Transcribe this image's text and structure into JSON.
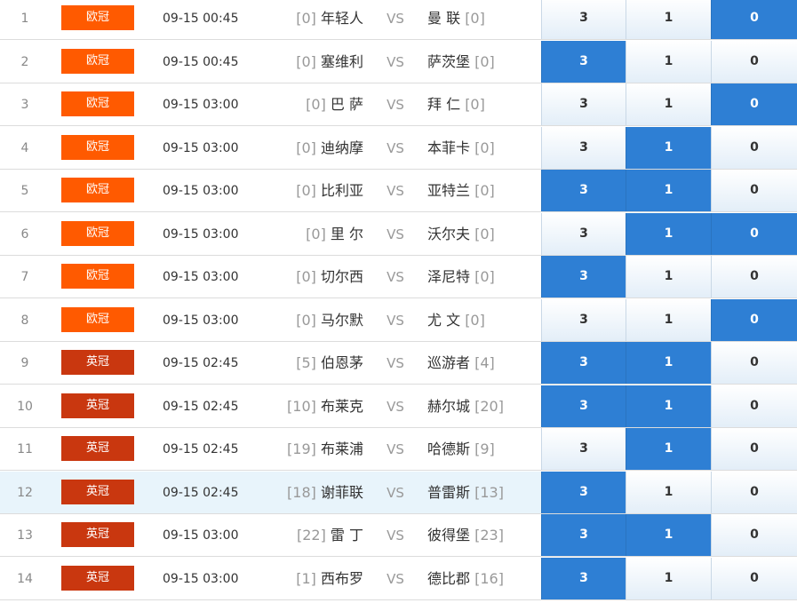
{
  "colors": {
    "league_ouguan": "#ff5a00",
    "league_yingguan": "#c9370f",
    "selected": "#2e7fd4",
    "highlight_row": "#e8f4fb"
  },
  "vs_label": "VS",
  "rows": [
    {
      "idx": "1",
      "league": "欧冠",
      "time": "09-15 00:45",
      "home_rank": "[0]",
      "home": "年轻人",
      "away": "曼 联",
      "away_rank": "[0]",
      "o3": "3",
      "o1": "1",
      "o0": "0"
    },
    {
      "idx": "2",
      "league": "欧冠",
      "time": "09-15 00:45",
      "home_rank": "[0]",
      "home": "塞维利",
      "away": "萨茨堡",
      "away_rank": "[0]",
      "o3": "3",
      "o1": "1",
      "o0": "0"
    },
    {
      "idx": "3",
      "league": "欧冠",
      "time": "09-15 03:00",
      "home_rank": "[0]",
      "home": "巴 萨",
      "away": "拜 仁",
      "away_rank": "[0]",
      "o3": "3",
      "o1": "1",
      "o0": "0"
    },
    {
      "idx": "4",
      "league": "欧冠",
      "time": "09-15 03:00",
      "home_rank": "[0]",
      "home": "迪纳摩",
      "away": "本菲卡",
      "away_rank": "[0]",
      "o3": "3",
      "o1": "1",
      "o0": "0"
    },
    {
      "idx": "5",
      "league": "欧冠",
      "time": "09-15 03:00",
      "home_rank": "[0]",
      "home": "比利亚",
      "away": "亚特兰",
      "away_rank": "[0]",
      "o3": "3",
      "o1": "1",
      "o0": "0"
    },
    {
      "idx": "6",
      "league": "欧冠",
      "time": "09-15 03:00",
      "home_rank": "[0]",
      "home": "里 尔",
      "away": "沃尔夫",
      "away_rank": "[0]",
      "o3": "3",
      "o1": "1",
      "o0": "0"
    },
    {
      "idx": "7",
      "league": "欧冠",
      "time": "09-15 03:00",
      "home_rank": "[0]",
      "home": "切尔西",
      "away": "泽尼特",
      "away_rank": "[0]",
      "o3": "3",
      "o1": "1",
      "o0": "0"
    },
    {
      "idx": "8",
      "league": "欧冠",
      "time": "09-15 03:00",
      "home_rank": "[0]",
      "home": "马尔默",
      "away": "尤 文",
      "away_rank": "[0]",
      "o3": "3",
      "o1": "1",
      "o0": "0"
    },
    {
      "idx": "9",
      "league": "英冠",
      "time": "09-15 02:45",
      "home_rank": "[5]",
      "home": "伯恩茅",
      "away": "巡游者",
      "away_rank": "[4]",
      "o3": "3",
      "o1": "1",
      "o0": "0"
    },
    {
      "idx": "10",
      "league": "英冠",
      "time": "09-15 02:45",
      "home_rank": "[10]",
      "home": "布莱克",
      "away": "赫尔城",
      "away_rank": "[20]",
      "o3": "3",
      "o1": "1",
      "o0": "0"
    },
    {
      "idx": "11",
      "league": "英冠",
      "time": "09-15 02:45",
      "home_rank": "[19]",
      "home": "布莱浦",
      "away": "哈德斯",
      "away_rank": "[9]",
      "o3": "3",
      "o1": "1",
      "o0": "0"
    },
    {
      "idx": "12",
      "league": "英冠",
      "time": "09-15 02:45",
      "home_rank": "[18]",
      "home": "谢菲联",
      "away": "普雷斯",
      "away_rank": "[13]",
      "o3": "3",
      "o1": "1",
      "o0": "0"
    },
    {
      "idx": "13",
      "league": "英冠",
      "time": "09-15 03:00",
      "home_rank": "[22]",
      "home": "雷 丁",
      "away": "彼得堡",
      "away_rank": "[23]",
      "o3": "3",
      "o1": "1",
      "o0": "0"
    },
    {
      "idx": "14",
      "league": "英冠",
      "time": "09-15 03:00",
      "home_rank": "[1]",
      "home": "西布罗",
      "away": "德比郡",
      "away_rank": "[16]",
      "o3": "3",
      "o1": "1",
      "o0": "0"
    }
  ],
  "selection": [
    [
      false,
      false,
      true
    ],
    [
      true,
      false,
      false
    ],
    [
      false,
      false,
      true
    ],
    [
      false,
      true,
      false
    ],
    [
      true,
      true,
      false
    ],
    [
      false,
      true,
      true
    ],
    [
      true,
      false,
      false
    ],
    [
      false,
      false,
      true
    ],
    [
      true,
      true,
      false
    ],
    [
      true,
      true,
      false
    ],
    [
      false,
      true,
      false
    ],
    [
      true,
      false,
      false
    ],
    [
      true,
      true,
      false
    ],
    [
      true,
      false,
      false
    ]
  ],
  "highlighted_row": 11
}
